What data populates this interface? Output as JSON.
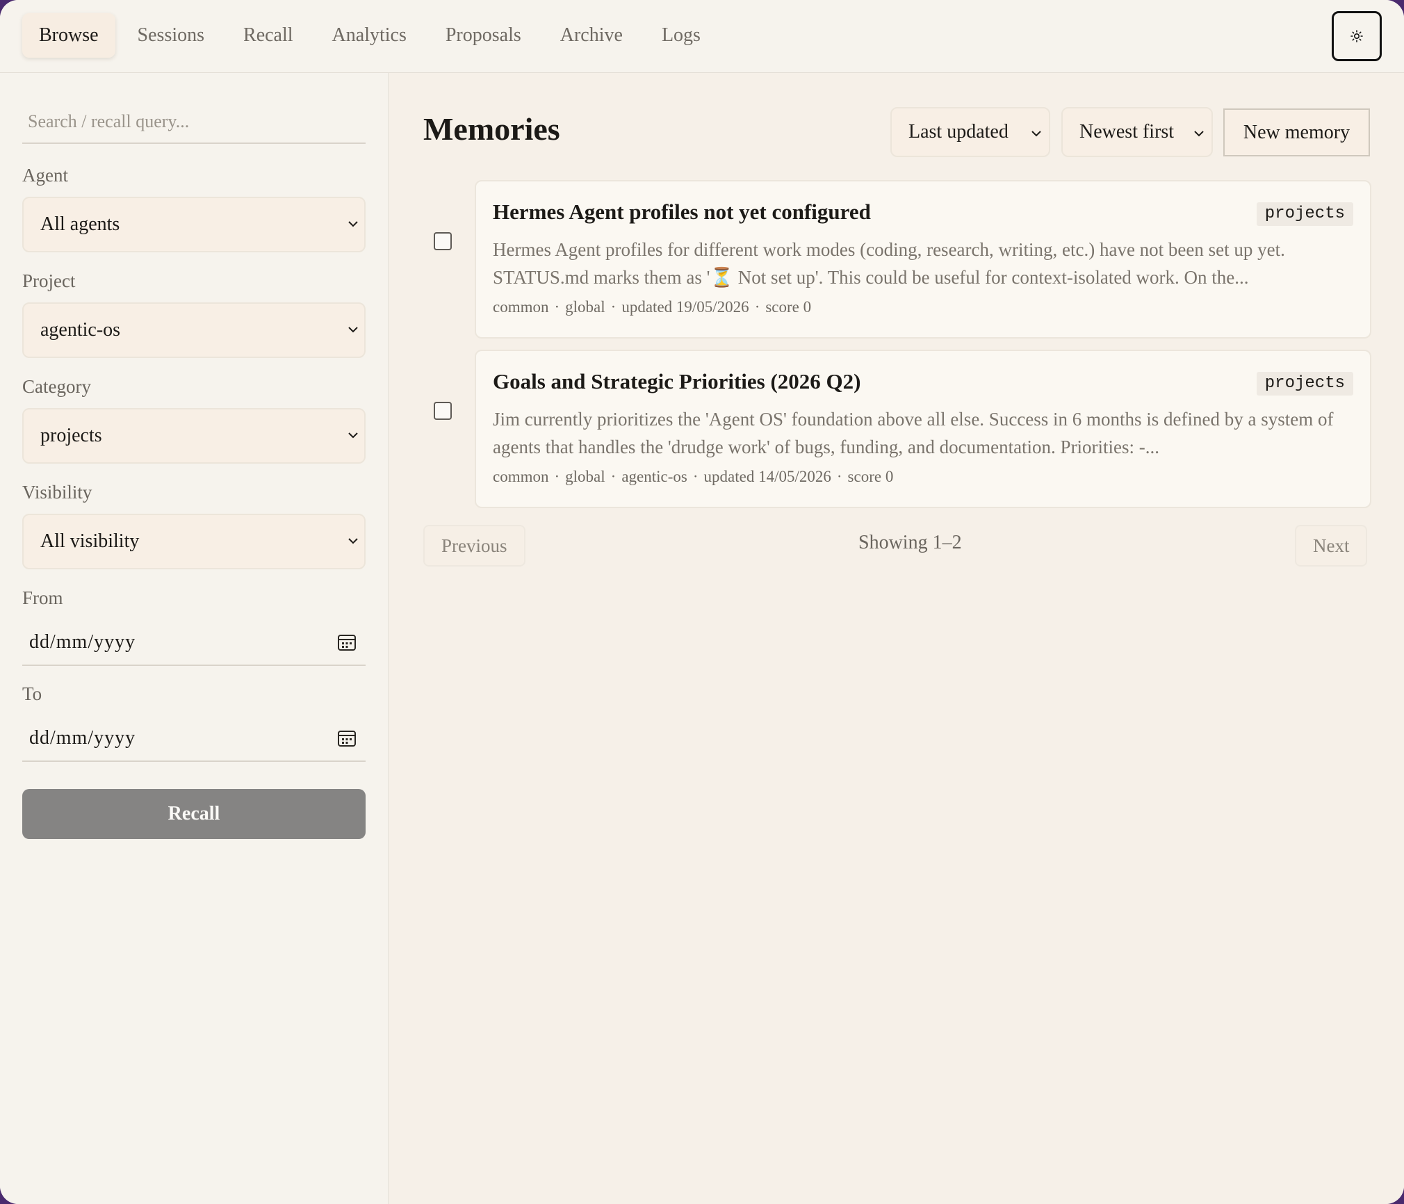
{
  "nav": {
    "tabs": [
      {
        "label": "Browse",
        "active": true
      },
      {
        "label": "Sessions",
        "active": false
      },
      {
        "label": "Recall",
        "active": false
      },
      {
        "label": "Analytics",
        "active": false
      },
      {
        "label": "Proposals",
        "active": false
      },
      {
        "label": "Archive",
        "active": false
      },
      {
        "label": "Logs",
        "active": false
      }
    ],
    "theme_toggle_icon": "sun-icon"
  },
  "sidebar": {
    "search_placeholder": "Search / recall query...",
    "agent": {
      "label": "Agent",
      "value": "All agents"
    },
    "project": {
      "label": "Project",
      "value": "agentic-os"
    },
    "category": {
      "label": "Category",
      "value": "projects"
    },
    "visibility": {
      "label": "Visibility",
      "value": "All visibility"
    },
    "from": {
      "label": "From",
      "placeholder": "dd/mm/yyyy"
    },
    "to": {
      "label": "To",
      "placeholder": "dd/mm/yyyy"
    },
    "recall_button": "Recall"
  },
  "main": {
    "title": "Memories",
    "sort_field": "Last updated",
    "sort_order": "Newest first",
    "new_button": "New memory",
    "memories": [
      {
        "title": "Hermes Agent profiles not yet configured",
        "tag": "projects",
        "body": "Hermes Agent profiles for different work modes (coding, research, writing, etc.) have not been set up yet. STATUS.md marks them as '⏳ Not set up'. This could be useful for context-isolated work. On the...",
        "meta": [
          "common",
          "global",
          "updated 19/05/2026",
          "score 0"
        ]
      },
      {
        "title": "Goals and Strategic Priorities (2026 Q2)",
        "tag": "projects",
        "body": "Jim currently prioritizes the 'Agent OS' foundation above all else. Success in 6 months is defined by a system of agents that handles the 'drudge work' of bugs, funding, and documentation. Priorities: -...",
        "meta": [
          "common",
          "global",
          "agentic-os",
          "updated 14/05/2026",
          "score 0"
        ]
      }
    ],
    "pager": {
      "previous": "Previous",
      "info": "Showing 1–2",
      "next": "Next"
    }
  },
  "colors": {
    "background": "#f5f2ec",
    "select_fill": "#f8efe5",
    "recall_button": "#858483",
    "frame": "#4a2a6e"
  }
}
